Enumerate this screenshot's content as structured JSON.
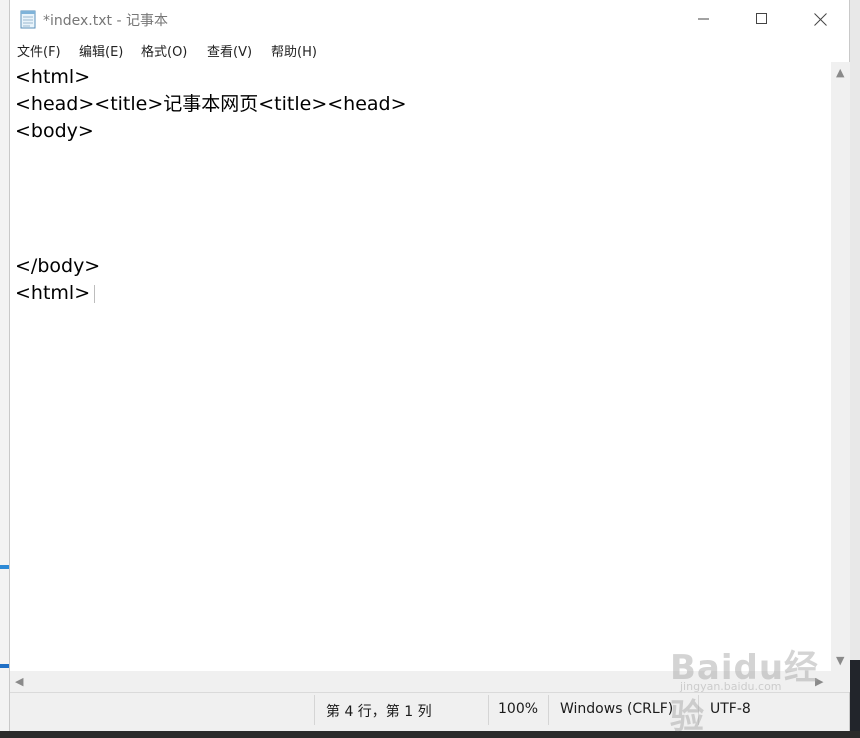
{
  "window": {
    "title": "*index.txt - 记事本",
    "app_icon": "notepad-icon"
  },
  "menubar": {
    "items": [
      {
        "label": "文件(F)"
      },
      {
        "label": "编辑(E)"
      },
      {
        "label": "格式(O)"
      },
      {
        "label": "查看(V)"
      },
      {
        "label": "帮助(H)"
      }
    ]
  },
  "editor": {
    "lines": [
      "<html>",
      "<head><title>记事本网页<title><head>",
      "<body>",
      "",
      "",
      "",
      "",
      "</body>",
      "<html>"
    ]
  },
  "statusbar": {
    "position": "第 4 行，第 1 列",
    "zoom": "100%",
    "line_ending": "Windows (CRLF)",
    "encoding": "UTF-8"
  },
  "watermark": {
    "logo_text": "Baidu经验",
    "url_text": "jingyan.baidu.com"
  }
}
